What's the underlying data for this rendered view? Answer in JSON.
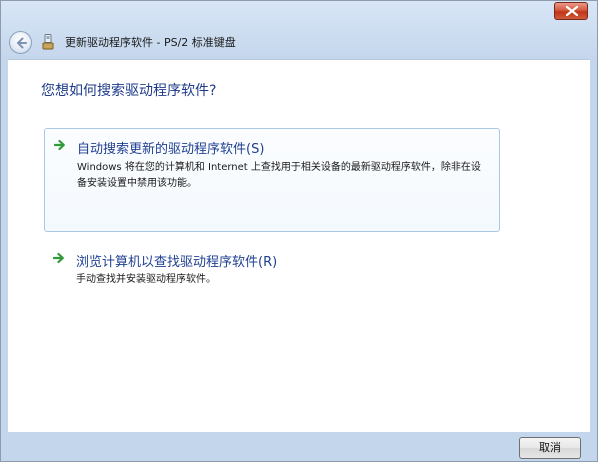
{
  "window": {
    "title": "更新驱动程序软件 - PS/2 标准键盘",
    "close_icon": "close-icon",
    "back_icon": "back-arrow-icon",
    "device_icon": "device-icon"
  },
  "main": {
    "question": "您想如何搜索驱动程序软件?",
    "options": [
      {
        "title": "自动搜索更新的驱动程序软件(S)",
        "description": "Windows 将在您的计算机和 Internet 上查找用于相关设备的最新驱动程序软件，除非在设备安装设置中禁用该功能。",
        "icon": "green-arrow-icon",
        "highlighted": true
      },
      {
        "title": "浏览计算机以查找驱动程序软件(R)",
        "description": "手动查找并安装驱动程序软件。",
        "icon": "green-arrow-icon",
        "highlighted": false
      }
    ]
  },
  "footer": {
    "cancel_label": "取消"
  },
  "colors": {
    "link_blue": "#1f3f8f",
    "heading_blue": "#1e3a8a",
    "arrow_green": "#2e9a3a",
    "close_red": "#c0341a"
  }
}
